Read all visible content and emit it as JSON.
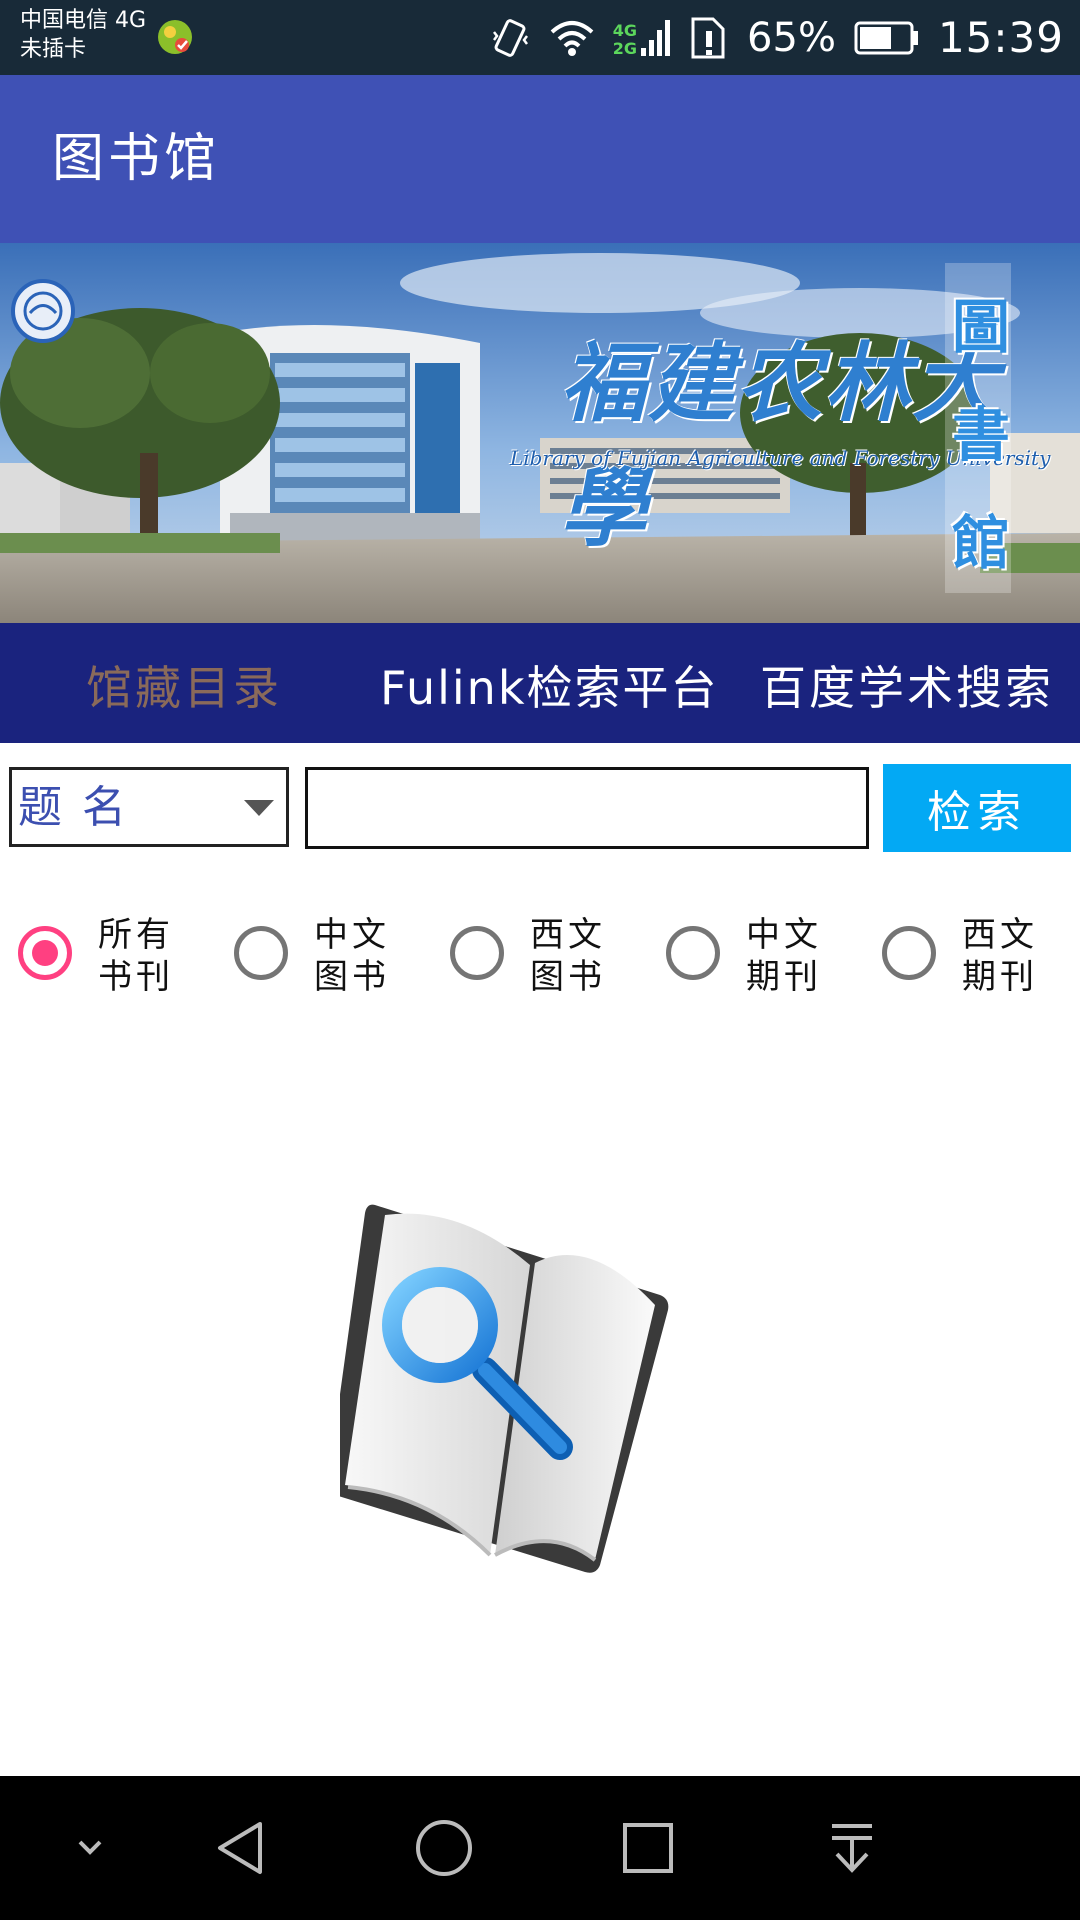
{
  "status_bar": {
    "carrier_line1": "中国电信 4G",
    "carrier_line2": "未插卡",
    "net_4g": "4G",
    "net_2g": "2G",
    "battery_percent": "65%",
    "battery_level": 0.65,
    "time": "15:39",
    "icons": [
      "app-badge-icon",
      "vibrate-icon",
      "wifi-icon",
      "signal-icon",
      "sim-icon",
      "battery-icon"
    ]
  },
  "app_bar": {
    "title": "图书馆",
    "color": "#3f51b5"
  },
  "banner": {
    "university_cn": "福建农林大學",
    "university_en": "Library of Fujian Agriculture and Forestry University",
    "vertical_text": "圖書館"
  },
  "tabs": [
    {
      "label": "馆藏目录",
      "selected": true
    },
    {
      "label": "Fulink检索平台",
      "selected": false
    },
    {
      "label": "百度学术搜索",
      "selected": false
    }
  ],
  "search": {
    "field_selected": "题名",
    "input_value": "",
    "button_label": "检索"
  },
  "doc_types": [
    {
      "label": "所有书刊",
      "checked": true
    },
    {
      "label": "中文图书",
      "checked": false
    },
    {
      "label": "西文图书",
      "checked": false
    },
    {
      "label": "中文期刊",
      "checked": false
    },
    {
      "label": "西文期刊",
      "checked": false
    }
  ],
  "illustration": "book-search-icon",
  "nav_bar": {
    "buttons": [
      "chevron-down-icon",
      "back-icon",
      "home-icon",
      "recents-icon",
      "download-icon"
    ]
  },
  "colors": {
    "accent": "#ff4081",
    "tab_strip": "#1a237e",
    "search_button": "#03a9f4",
    "status_bar": "#182a38"
  }
}
